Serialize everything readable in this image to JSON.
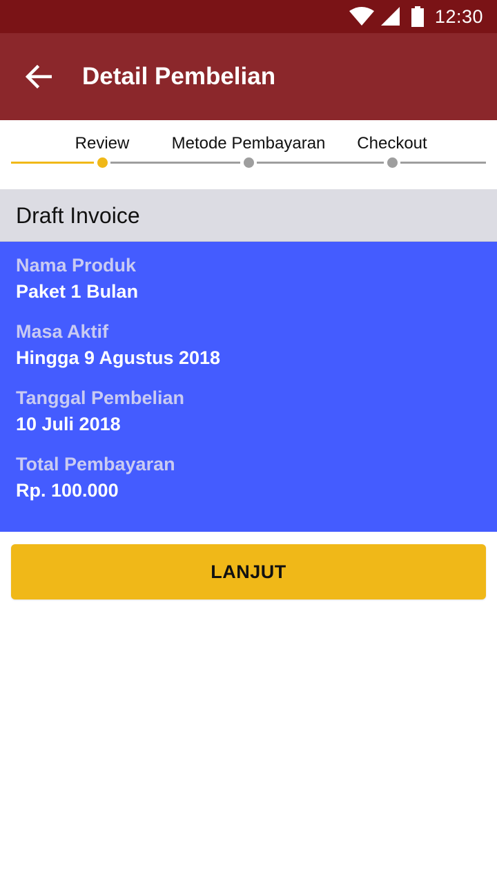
{
  "status_bar": {
    "time": "12:30",
    "icons": [
      "wifi-icon",
      "signal-icon",
      "battery-icon"
    ]
  },
  "app_bar": {
    "back_icon": "arrow-left-icon",
    "title": "Detail Pembelian"
  },
  "stepper": {
    "steps": [
      {
        "label": "Review",
        "state": "active"
      },
      {
        "label": "Metode Pembayaran",
        "state": "pending"
      },
      {
        "label": "Checkout",
        "state": "pending"
      }
    ]
  },
  "invoice": {
    "title": "Draft Invoice",
    "fields": [
      {
        "label": "Nama Produk",
        "value": "Paket 1 Bulan"
      },
      {
        "label": "Masa Aktif",
        "value": "Hingga 9 Agustus 2018"
      },
      {
        "label": "Tanggal Pembelian",
        "value": "10 Juli 2018"
      },
      {
        "label": "Total Pembayaran",
        "value": "Rp. 100.000"
      }
    ]
  },
  "actions": {
    "continue_label": "LANJUT"
  },
  "colors": {
    "status_bar": "#7a1316",
    "app_bar": "#8b272b",
    "accent": "#f0b818",
    "card": "#445cff",
    "inactive": "#9e9e9e",
    "section_header": "#dcdce3"
  }
}
